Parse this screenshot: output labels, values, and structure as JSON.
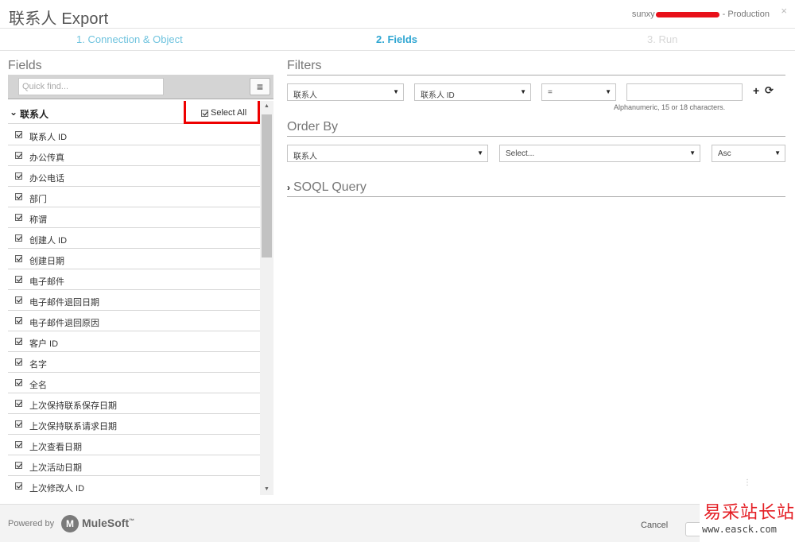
{
  "window": {
    "title": "联系人 Export",
    "account_prefix": "sunxy",
    "account_suffix": " - Production",
    "close_glyph": "×"
  },
  "steps": [
    {
      "label": "1. Connection & Object",
      "state": "done"
    },
    {
      "label": "2. Fields",
      "state": "active"
    },
    {
      "label": "3. Run",
      "state": "pending"
    }
  ],
  "fields_panel": {
    "heading": "Fields",
    "quick_find_placeholder": "Quick find...",
    "menu_icon": "≡",
    "group": {
      "label": "联系人",
      "select_all_label": "Select All",
      "select_all_checked": true
    },
    "items": [
      {
        "label": "联系人 ID",
        "checked": true
      },
      {
        "label": "办公传真",
        "checked": true
      },
      {
        "label": "办公电话",
        "checked": true
      },
      {
        "label": "部门",
        "checked": true
      },
      {
        "label": "称谓",
        "checked": true
      },
      {
        "label": "创建人 ID",
        "checked": true
      },
      {
        "label": "创建日期",
        "checked": true
      },
      {
        "label": "电子邮件",
        "checked": true
      },
      {
        "label": "电子邮件退回日期",
        "checked": true
      },
      {
        "label": "电子邮件退回原因",
        "checked": true
      },
      {
        "label": "客户 ID",
        "checked": true
      },
      {
        "label": "名字",
        "checked": true
      },
      {
        "label": "全名",
        "checked": true
      },
      {
        "label": "上次保持联系保存日期",
        "checked": true
      },
      {
        "label": "上次保持联系请求日期",
        "checked": true
      },
      {
        "label": "上次查看日期",
        "checked": true
      },
      {
        "label": "上次活动日期",
        "checked": true
      },
      {
        "label": "上次修改人 ID",
        "checked": true
      }
    ]
  },
  "filters": {
    "heading": "Filters",
    "object_value": "联系人",
    "field_value": "联系人 ID",
    "operator_value": "=",
    "value": "",
    "hint": "Alphanumeric, 15 or 18 characters.",
    "add_icon": "+",
    "refresh_icon": "⟳"
  },
  "order_by": {
    "heading": "Order By",
    "object_value": "联系人",
    "field_value": "Select...",
    "direction_value": "Asc"
  },
  "soql": {
    "heading": "SOQL Query",
    "chevron": "›"
  },
  "footer": {
    "powered_by": "Powered by",
    "brand": "MuleSoft",
    "brand_mark": "M",
    "trademark": "™",
    "cancel_label": "Cancel"
  },
  "watermark": {
    "cn": "易采站长站",
    "url": "www.easck.com"
  },
  "colors": {
    "step_done": "#6fc3de",
    "step_active": "#2fa6d2",
    "step_pending": "#d7d7d7",
    "highlight_box": "#ee0000",
    "redaction": "#e8101a"
  }
}
